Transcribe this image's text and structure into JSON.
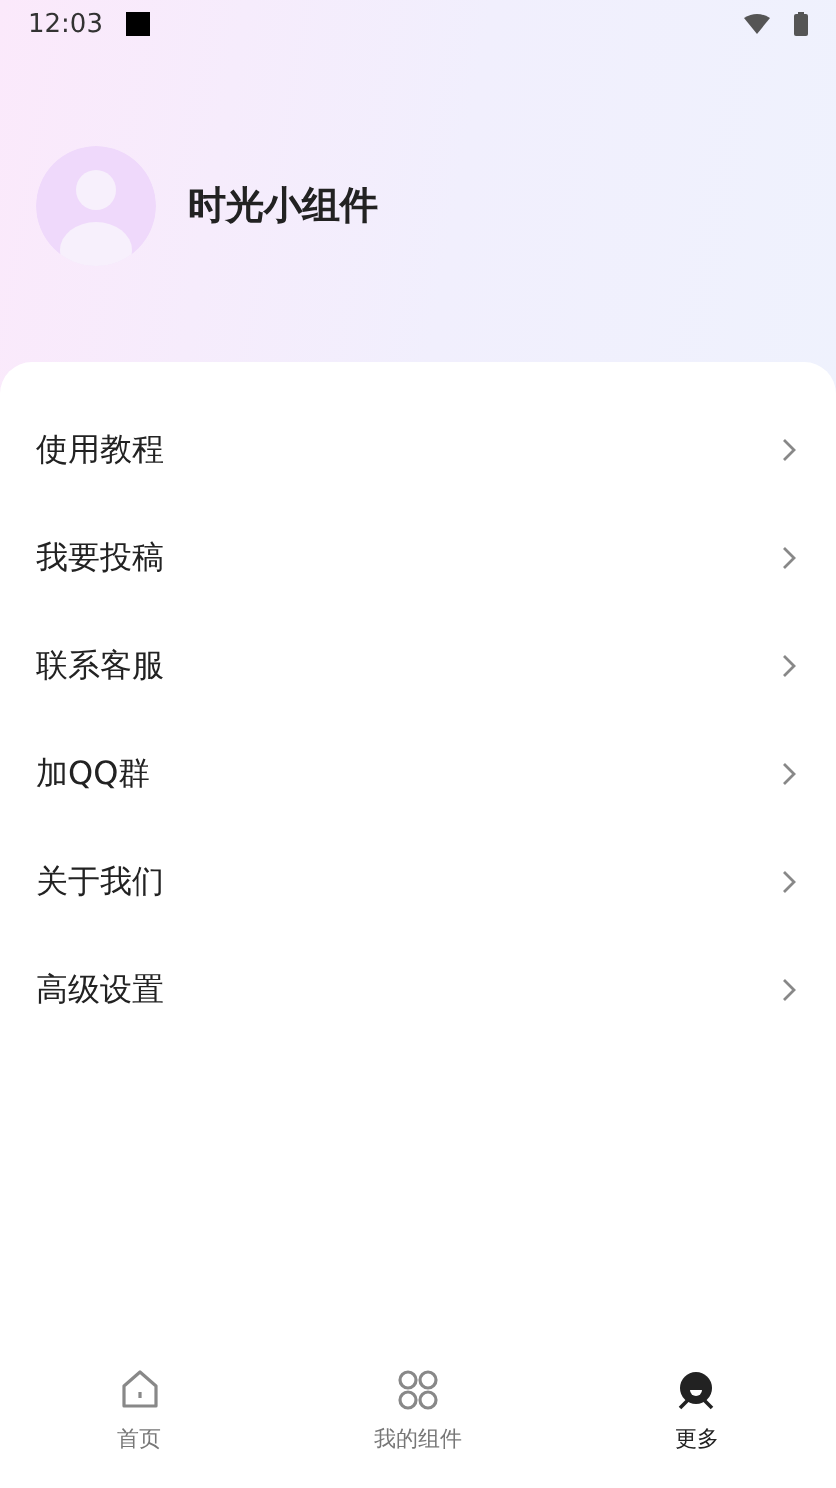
{
  "status_bar": {
    "time": "12:03"
  },
  "profile": {
    "name": "时光小组件"
  },
  "menu": [
    {
      "label": "使用教程"
    },
    {
      "label": "我要投稿"
    },
    {
      "label": "联系客服"
    },
    {
      "label": "加QQ群"
    },
    {
      "label": "关于我们"
    },
    {
      "label": "高级设置"
    }
  ],
  "tabs": [
    {
      "label": "首页",
      "kind": "home",
      "selected": false
    },
    {
      "label": "我的组件",
      "kind": "widgets",
      "selected": false
    },
    {
      "label": "更多",
      "kind": "more",
      "selected": true
    }
  ]
}
